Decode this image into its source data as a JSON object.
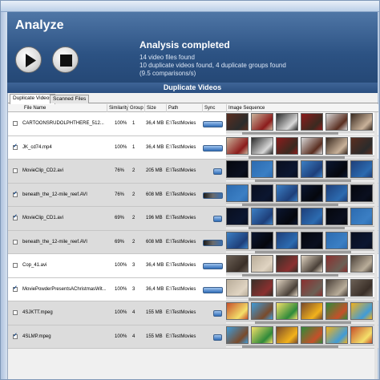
{
  "header": {
    "title": "Analyze",
    "status_title": "Analysis completed",
    "status_lines": [
      "14 video files found",
      "10 duplicate videos found, 4 duplicate groups found",
      "(9.5 comparisons/s)"
    ]
  },
  "section_title": "Duplicate Videos",
  "tabs": [
    "Duplicate Videos",
    "Scanned Files"
  ],
  "columns": [
    "File Name",
    "Similarity",
    "Group",
    "Size",
    "Path",
    "Sync",
    "Image Sequence"
  ],
  "rows": [
    {
      "checked": false,
      "name": "CARTOONSRUDOLPHTHERE_512...",
      "similarity": "100%",
      "group": "1",
      "size": "36,4 MB",
      "path": "E:\\TestMovies",
      "shade": "white",
      "sync": "blue"
    },
    {
      "checked": true,
      "name": "JK_cd74.mp4",
      "similarity": "100%",
      "group": "1",
      "size": "36,4 MB",
      "path": "E:\\TestMovies",
      "shade": "white",
      "sync": "blue"
    },
    {
      "checked": false,
      "name": "MovieClip_CD2.avi",
      "similarity": "76%",
      "group": "2",
      "size": "205 MB",
      "path": "E:\\TestMovies",
      "shade": "grey",
      "sync": "blue-small"
    },
    {
      "checked": true,
      "name": "beneath_the_12-mile_reef.AVI",
      "similarity": "76%",
      "group": "2",
      "size": "608 MB",
      "path": "E:\\TestMovies",
      "shade": "grey",
      "sync": "dark"
    },
    {
      "checked": true,
      "name": "MovieClip_CD1.avi",
      "similarity": "69%",
      "group": "2",
      "size": "196 MB",
      "path": "E:\\TestMovies",
      "shade": "grey",
      "sync": "blue-small"
    },
    {
      "checked": false,
      "name": "beneath_the_12-mile_reef.AVI",
      "similarity": "69%",
      "group": "2",
      "size": "608 MB",
      "path": "E:\\TestMovies",
      "shade": "grey",
      "sync": "dark"
    },
    {
      "checked": false,
      "name": "Cop_41.avi",
      "similarity": "100%",
      "group": "3",
      "size": "36,4 MB",
      "path": "E:\\TestMovies",
      "shade": "white",
      "sync": "blue"
    },
    {
      "checked": true,
      "name": "MoviePowderPresentsAChristmasWit...",
      "similarity": "100%",
      "group": "3",
      "size": "36,4 MB",
      "path": "E:\\TestMovies",
      "shade": "white",
      "sync": "blue"
    },
    {
      "checked": false,
      "name": "4SJKTT.mpeg",
      "similarity": "100%",
      "group": "4",
      "size": "155 MB",
      "path": "E:\\TestMovies",
      "shade": "grey",
      "sync": "blue-small"
    },
    {
      "checked": true,
      "name": "4SLMP.mpeg",
      "similarity": "100%",
      "group": "4",
      "size": "155 MB",
      "path": "E:\\TestMovies",
      "shade": "grey",
      "sync": "blue-small"
    }
  ],
  "thumb_palettes": {
    "1": [
      "#5a2e20",
      "#c9b29a",
      "#2b2b2b",
      "#8c1c1c",
      "#d8d8d8",
      "#3a2a20"
    ],
    "2": [
      "#0b1630",
      "#1e3f7a",
      "#05070d",
      "#2c6bb0",
      "#0a0f1f",
      "#3b7fc4"
    ],
    "3": [
      "#6b6055",
      "#b9ad9a",
      "#3a2f28",
      "#e0d4c2",
      "#8a3030",
      "#4a4038"
    ],
    "4": [
      "#2e8a3a",
      "#f2b21c",
      "#c6502a",
      "#3f9bd8",
      "#f4e06a",
      "#7a4a2a"
    ]
  }
}
